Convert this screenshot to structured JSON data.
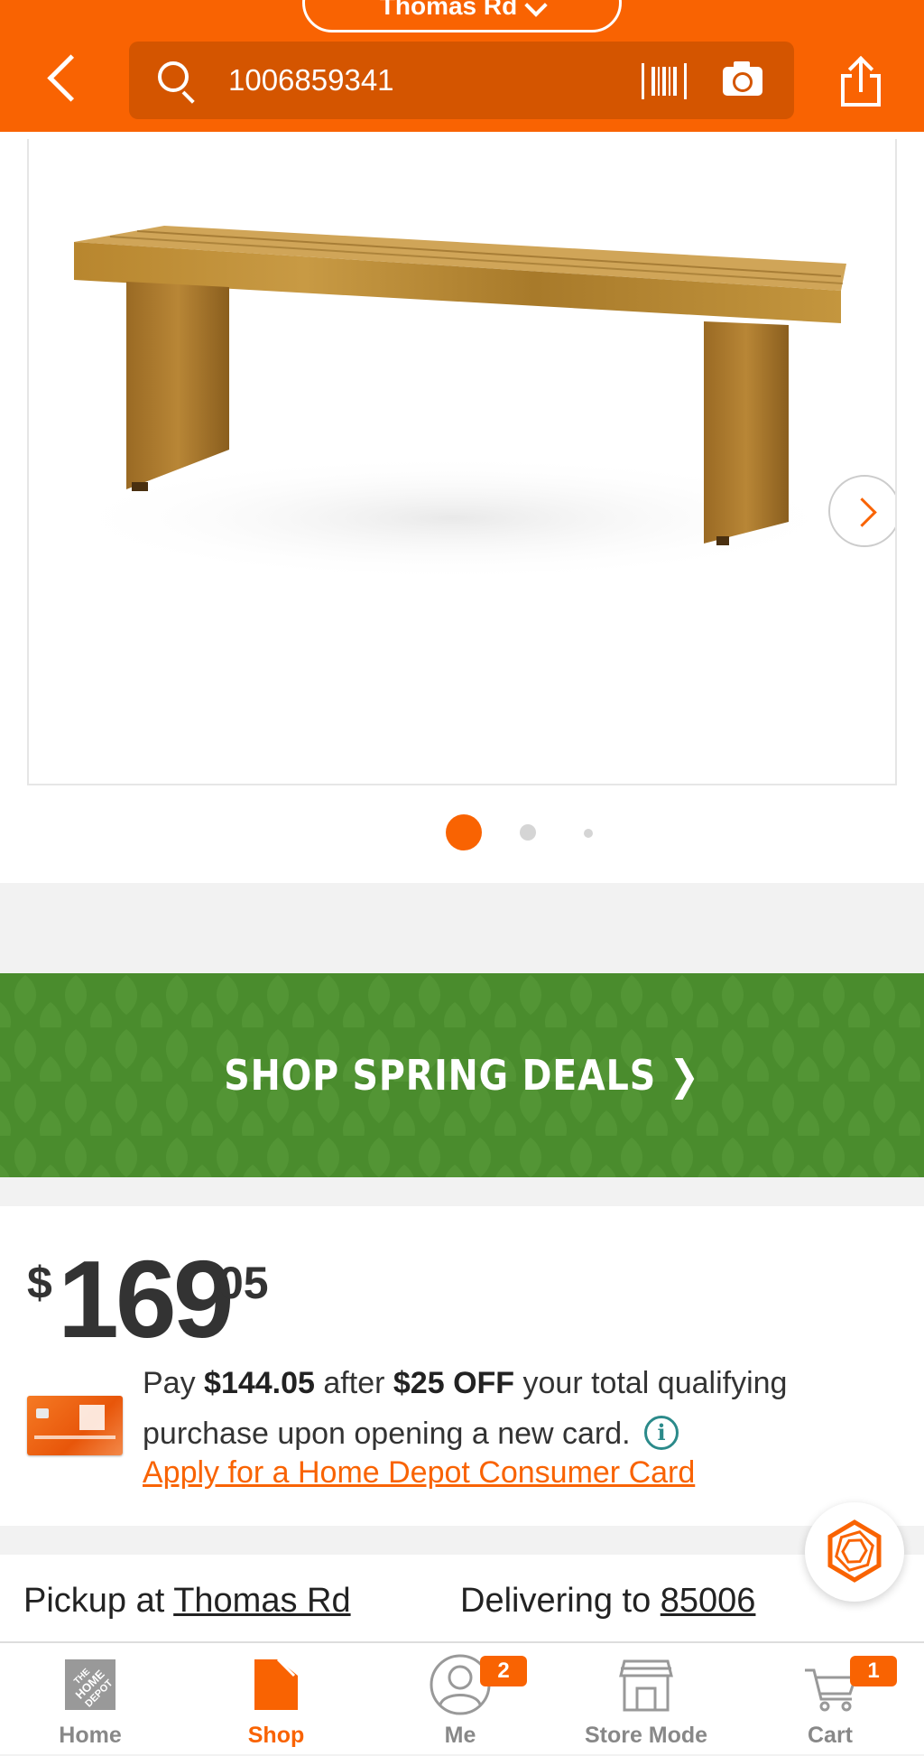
{
  "header": {
    "store_name": "Thomas Rd",
    "search_query": "1006859341"
  },
  "gallery": {
    "image_alt": "Wooden outdoor bench",
    "active_slide": 1,
    "slide_count": 3
  },
  "promo": {
    "label": "SHOP SPRING DEALS ❯"
  },
  "price": {
    "symbol": "$",
    "dollars": "169",
    "cents": "05"
  },
  "card_offer": {
    "pay_label": "Pay ",
    "pay_amount": "$144.05",
    "after_label": " after ",
    "discount": "$25 OFF",
    "rest_line1": " your total qualifying",
    "rest_line2": "purchase upon opening a new card.",
    "info_glyph": "i",
    "apply_link": "Apply for a Home Depot Consumer Card"
  },
  "fulfillment": {
    "pickup_label": "Pickup at ",
    "pickup_store": "Thomas Rd",
    "delivery_label": "Delivering to ",
    "delivery_zip": "85006"
  },
  "bottom_nav": {
    "items": [
      {
        "label": "Home",
        "icon": "home-depot-logo-icon"
      },
      {
        "label": "Shop",
        "icon": "shop-icon",
        "active": true
      },
      {
        "label": "Me",
        "icon": "user-icon",
        "badge": "2"
      },
      {
        "label": "Store Mode",
        "icon": "store-icon"
      },
      {
        "label": "Cart",
        "icon": "cart-icon",
        "badge": "1"
      }
    ]
  },
  "colors": {
    "brand_orange": "#f96302",
    "promo_green": "#4a8c2d",
    "info_teal": "#2b8a8a"
  }
}
